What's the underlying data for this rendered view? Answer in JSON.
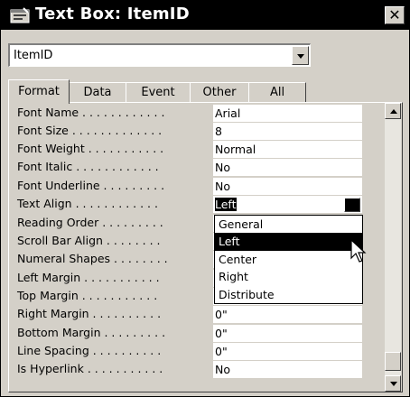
{
  "window": {
    "title": "Text Box: ItemID",
    "close_glyph": "✕"
  },
  "object_selector": {
    "value": "ItemID"
  },
  "tabs": [
    {
      "label": "Format",
      "active": true
    },
    {
      "label": "Data",
      "active": false
    },
    {
      "label": "Event",
      "active": false
    },
    {
      "label": "Other",
      "active": false
    },
    {
      "label": "All",
      "active": false
    }
  ],
  "properties": [
    {
      "label": "Font Name . . . . . . . . . . . .",
      "value": "Arial"
    },
    {
      "label": "Font Size . . . . . . . . . . . . .",
      "value": "8"
    },
    {
      "label": "Font Weight . . . . . . . . . . .",
      "value": "Normal"
    },
    {
      "label": "Font Italic . . . . . . . . . . . .",
      "value": "No"
    },
    {
      "label": "Font Underline . . . . . . . . .",
      "value": "No"
    },
    {
      "label": "Text Align . . . . . . . . . . . .",
      "value": "Left"
    },
    {
      "label": "Reading Order . . . . . . . . .",
      "value": ""
    },
    {
      "label": "Scroll Bar Align . . . . . . . .",
      "value": ""
    },
    {
      "label": "Numeral Shapes . . . . . . . .",
      "value": ""
    },
    {
      "label": "Left Margin . . . . . . . . . . .",
      "value": ""
    },
    {
      "label": "Top Margin . . . . . . . . . . .",
      "value": ""
    },
    {
      "label": "Right Margin . . . . . . . . . .",
      "value": "0\""
    },
    {
      "label": "Bottom Margin . . . . . . . . .",
      "value": "0\""
    },
    {
      "label": "Line Spacing . . . . . . . . . .",
      "value": "0\""
    },
    {
      "label": "Is Hyperlink . . . . . . . . . . .",
      "value": "No"
    }
  ],
  "text_align_dropdown": {
    "options": [
      "General",
      "Left",
      "Center",
      "Right",
      "Distribute"
    ],
    "highlighted": "Left"
  },
  "icons": {
    "title": "textbox-properties-icon",
    "cursor": "mouse-pointer-icon"
  }
}
